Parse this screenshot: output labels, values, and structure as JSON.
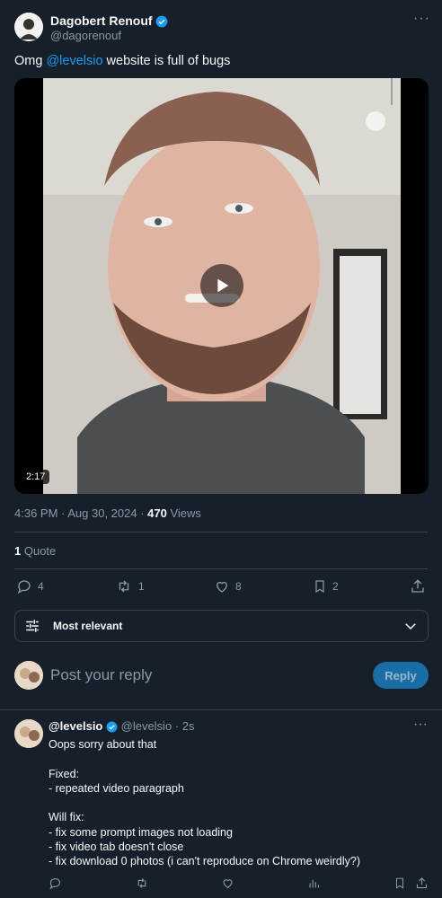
{
  "post": {
    "author_name": "Dagobert Renouf",
    "author_handle": "@dagorenouf",
    "text_prefix": "Omg ",
    "mention": "@levelsio",
    "text_suffix": " website is full of bugs",
    "video_duration": "2:17",
    "meta_time": "4:36 PM · Aug 30, 2024 · ",
    "views_count": "470",
    "views_label": " Views",
    "quote_count": "1",
    "quote_label": " Quote"
  },
  "actions": {
    "replies": "4",
    "reposts": "1",
    "likes": "8",
    "bookmarks": "2"
  },
  "sort": {
    "label": "Most relevant"
  },
  "composer": {
    "placeholder": "Post your reply",
    "reply_button": "Reply"
  },
  "reply": {
    "author_name": "@levelsio",
    "author_handle": "@levelsio",
    "time": "2s",
    "lines": [
      "Oops sorry about that",
      "",
      "Fixed:",
      "- repeated video paragraph",
      "",
      "Will fix:",
      "- fix some prompt images not loading",
      "- fix video tab doesn't close",
      "- fix download 0 photos (i can't reproduce on Chrome weirdly?)"
    ]
  },
  "colors": {
    "background": "#15202b",
    "accent": "#1d9bf0",
    "muted": "#8b98a5",
    "border": "#38444d"
  }
}
